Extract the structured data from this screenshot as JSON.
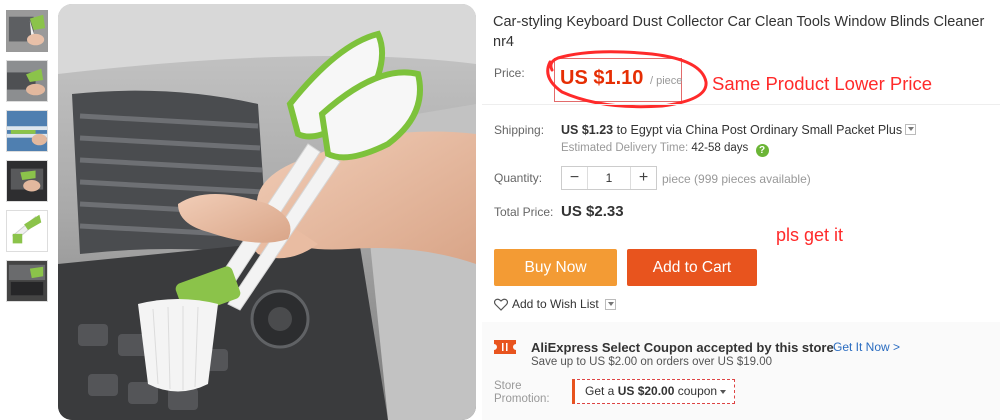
{
  "product": {
    "title": "Car-styling Keyboard Dust Collector Car Clean Tools Window Blinds Cleaner nr4",
    "price_label": "Price:",
    "price_value": "US $1.10",
    "price_unit": "/ piece",
    "shipping_label": "Shipping:",
    "shipping_price": "US $1.23",
    "shipping_text": " to Egypt via China Post Ordinary Small Packet Plus",
    "delivery_label": "Estimated Delivery Time:",
    "delivery_days": "42-58 days",
    "delivery_help_icon": "question-icon",
    "quantity_label": "Quantity:",
    "quantity_value": "1",
    "quantity_minus": "−",
    "quantity_plus": "+",
    "quantity_available": "piece (999 pieces available)",
    "total_label": "Total Price:",
    "total_value": "US $2.33"
  },
  "actions": {
    "buy_now": "Buy Now",
    "add_to_cart": "Add to Cart",
    "wishlist": "Add to Wish List"
  },
  "coupon": {
    "title": "AliExpress Select Coupon accepted by this store",
    "subtitle": "Save up to US $2.00 on orders over US $19.00",
    "link": "Get It Now >",
    "promo_label_1": "Store",
    "promo_label_2": "Promotion:",
    "promo_prefix": "Get a ",
    "promo_amount": "US $20.00",
    "promo_suffix": " coupon"
  },
  "annotations": {
    "price_note": "Same Product Lower Price",
    "request_note": "pls get it",
    "color": "#ff2a2a"
  },
  "gallery": {
    "thumbnail_count": 6,
    "active_index": 0
  },
  "colors": {
    "price": "#e62e04",
    "buy_now": "#f39b34",
    "add_to_cart": "#e8541e",
    "link": "#2a6cc0",
    "brush_green": "#7dc23b"
  }
}
